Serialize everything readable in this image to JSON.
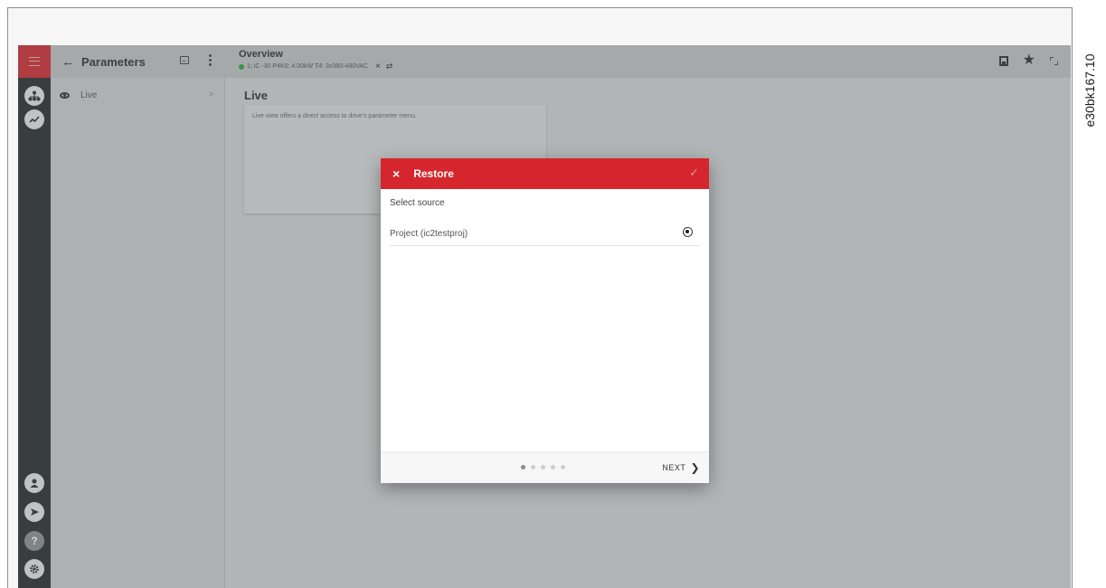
{
  "doc_ref": "e30bk167.10",
  "panel": {
    "back_icon": "arrow-left-icon",
    "title": "Parameters",
    "items": [
      {
        "icon": "eye-icon",
        "label": "Live",
        "chevron": ">"
      }
    ]
  },
  "overview": {
    "title": "Overview",
    "device": "1; iC  -30 P4K0: 4.00kW T4: 3x380-480VAC",
    "close_glyph": "×",
    "link_glyph": "⇄"
  },
  "topbar_icons": [
    "save-icon",
    "star-icon",
    "fullscreen-icon"
  ],
  "rail_icons": [
    "menu-icon",
    "network-icon",
    "trend-icon",
    "user-icon",
    "send-icon",
    "help-icon",
    "settings-icon"
  ],
  "rail_glyphs": {
    "help": "?"
  },
  "main": {
    "heading": "Live",
    "card_text": "Live view offers a direct access to drive's parameter menu."
  },
  "dialog": {
    "close_glyph": "×",
    "title": "Restore",
    "confirm_glyph": "✓",
    "section_label": "Select source",
    "options": [
      {
        "label": "Project (ic2testproj)",
        "selected": true
      }
    ],
    "steps_total": 5,
    "step_current": 1,
    "next_label": "NEXT",
    "next_glyph": "❯"
  },
  "colors": {
    "accent": "#d5262d",
    "rail": "#2c2e31",
    "status_ok": "#27a844"
  }
}
